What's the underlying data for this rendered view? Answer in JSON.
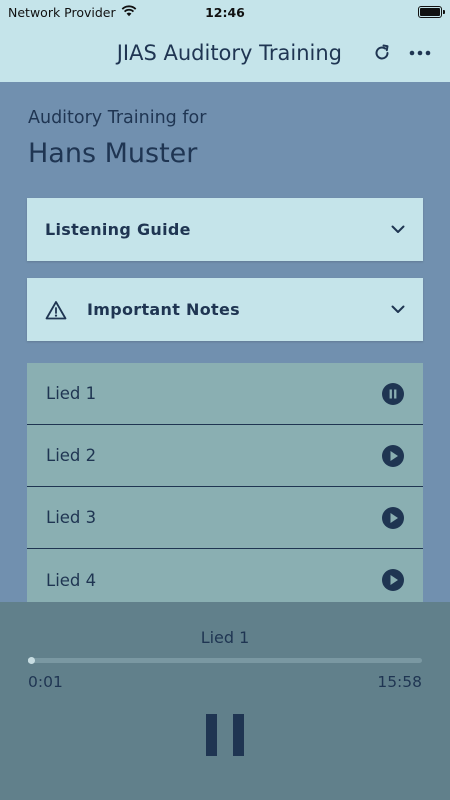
{
  "status_bar": {
    "carrier": "Network Provider",
    "time": "12:46"
  },
  "app_bar": {
    "title": "JIAS Auditory Training",
    "refresh_icon": "refresh-icon",
    "more_icon": "more-horizontal-icon"
  },
  "header": {
    "subtitle": "Auditory Training for",
    "name": "Hans Muster"
  },
  "panels": [
    {
      "label": "Listening Guide",
      "icon": "chevron-down-icon"
    },
    {
      "label": "Important Notes",
      "icon": "warning-icon"
    }
  ],
  "songs": [
    {
      "label": "Lied 1",
      "state": "playing",
      "icon": "pause-circle-icon"
    },
    {
      "label": "Lied 2",
      "state": "stopped",
      "icon": "play-circle-icon"
    },
    {
      "label": "Lied 3",
      "state": "stopped",
      "icon": "play-circle-icon"
    },
    {
      "label": "Lied 4",
      "state": "stopped",
      "icon": "play-circle-icon"
    }
  ],
  "player": {
    "now_playing": "Lied 1",
    "current_time": "0:01",
    "duration": "15:58",
    "progress": 0.001
  },
  "colors": {
    "background": "#7190af",
    "header_bar": "#c5e4ea",
    "song_row": "#8aafb2",
    "player_bg": "#61808b",
    "text_dark": "#1f3552"
  }
}
